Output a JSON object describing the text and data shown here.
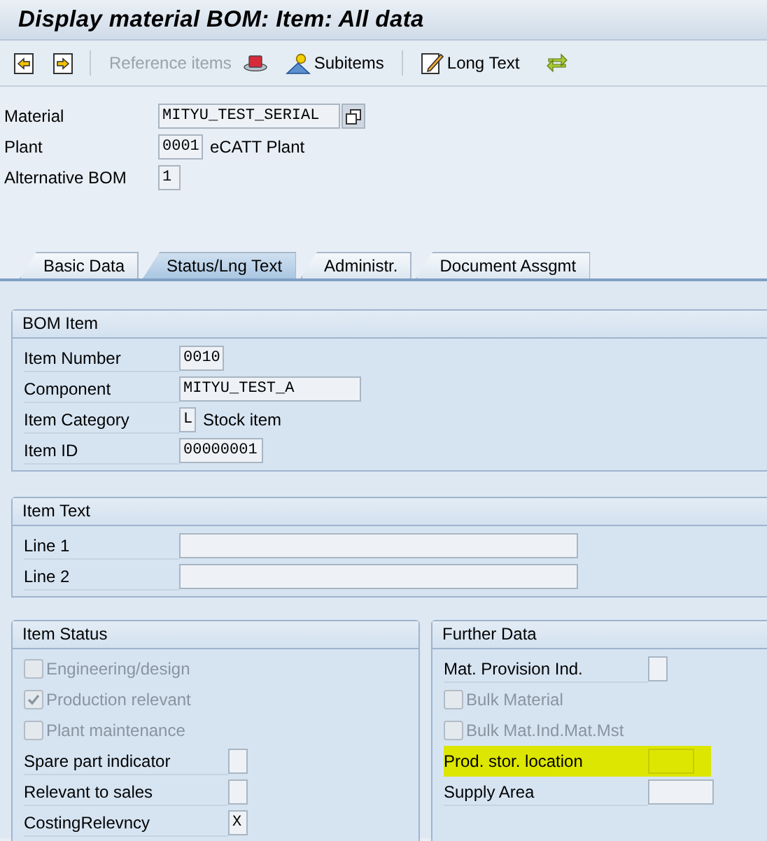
{
  "window": {
    "title": "Display material BOM: Item: All data"
  },
  "toolbar": [
    {
      "label": "Reference items",
      "disabled": true
    },
    {
      "label": "Subitems",
      "disabled": false
    },
    {
      "label": "Long Text",
      "disabled": false
    }
  ],
  "header": [
    {
      "label": "Material",
      "value": "MITYU_TEST_SERIAL"
    },
    {
      "label": "Plant",
      "value": "0001",
      "description": "eCATT Plant"
    },
    {
      "label": "Alternative BOM",
      "value": "1"
    }
  ],
  "tabs": [
    {
      "label": "Basic Data",
      "selected": false
    },
    {
      "label": "Status/Lng Text",
      "selected": true
    },
    {
      "label": "Administr.",
      "selected": false
    },
    {
      "label": "Document Assgmt",
      "selected": false
    }
  ],
  "bom_item": {
    "title": "BOM Item",
    "rows": [
      {
        "kind": "field",
        "label": "Item Number",
        "value": "0010"
      },
      {
        "kind": "field",
        "label": "Component",
        "value": "MITYU_TEST_A"
      },
      {
        "kind": "field",
        "label": "Item Category",
        "value": "L",
        "description": "Stock item"
      },
      {
        "kind": "field",
        "label": "Item ID",
        "value": "00000001"
      }
    ]
  },
  "item_text": {
    "title": "Item Text",
    "rows": [
      {
        "kind": "field",
        "label": "Line 1"
      },
      {
        "kind": "field",
        "label": "Line 2"
      }
    ]
  },
  "item_status": {
    "title": "Item Status",
    "rows": [
      {
        "kind": "checkbox",
        "label": "Engineering/design",
        "checked": false,
        "disabled": true
      },
      {
        "kind": "checkbox",
        "label": "Production relevant",
        "checked": true,
        "disabled": true
      },
      {
        "kind": "checkbox",
        "label": "Plant maintenance",
        "checked": false,
        "disabled": true
      },
      {
        "kind": "field",
        "label": "Spare part indicator"
      },
      {
        "kind": "field",
        "label": "Relevant to sales"
      },
      {
        "kind": "field",
        "label": "CostingRelevncy",
        "value": "X"
      }
    ]
  },
  "further_data": {
    "title": "Further Data",
    "rows": [
      {
        "kind": "field",
        "label": "Mat. Provision Ind.",
        "highlighted": false
      },
      {
        "kind": "checkbox",
        "label": "Bulk Material",
        "checked": false,
        "disabled": true
      },
      {
        "kind": "checkbox",
        "label": "Bulk Mat.Ind.Mat.Mst",
        "checked": false,
        "disabled": true
      },
      {
        "kind": "field",
        "label": "Prod. stor. location",
        "highlighted": true
      },
      {
        "kind": "field",
        "label": "Supply Area",
        "highlighted": false
      }
    ]
  }
}
